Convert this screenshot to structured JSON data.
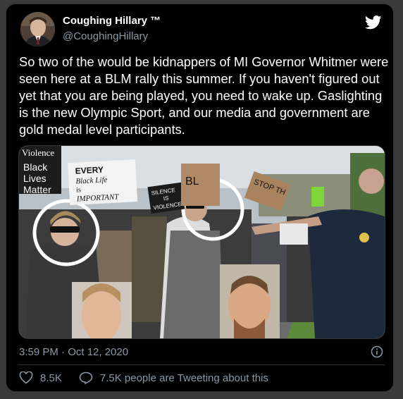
{
  "tweet": {
    "display_name": "Coughing Hillary ™",
    "handle": "@CoughingHillary",
    "text": "So two of the would be kidnappers of MI Governor Whitmer were seen here at a BLM rally this summer. If you haven't figured out yet that you are being played, you need to wake up. Gaslighting is the new Olympic Sport, and our media and government are gold medal level participants.",
    "timestamp": "3:59 PM · Oct 12, 2020",
    "likes": "8.5K",
    "retweet_text": "7.5K people are Tweeting about this"
  },
  "signs": {
    "violence": "Violence",
    "blm": [
      "Black",
      "Lives",
      "Matter"
    ],
    "every": [
      "EVERY",
      "Black Life",
      "is",
      "IMPORTANT"
    ],
    "silence": [
      "SILENCE",
      "IS",
      "VIOLENCE"
    ],
    "bl": "BL",
    "stop": "STOP TH"
  },
  "colors": {
    "background": "#000000",
    "text": "#ffffff",
    "muted": "#8b98a5",
    "border": "#2f3336",
    "bird": "#ffffff"
  },
  "icons": {
    "bird": "twitter-bird-icon",
    "info": "info-icon",
    "heart": "heart-icon",
    "comment": "comment-icon"
  }
}
